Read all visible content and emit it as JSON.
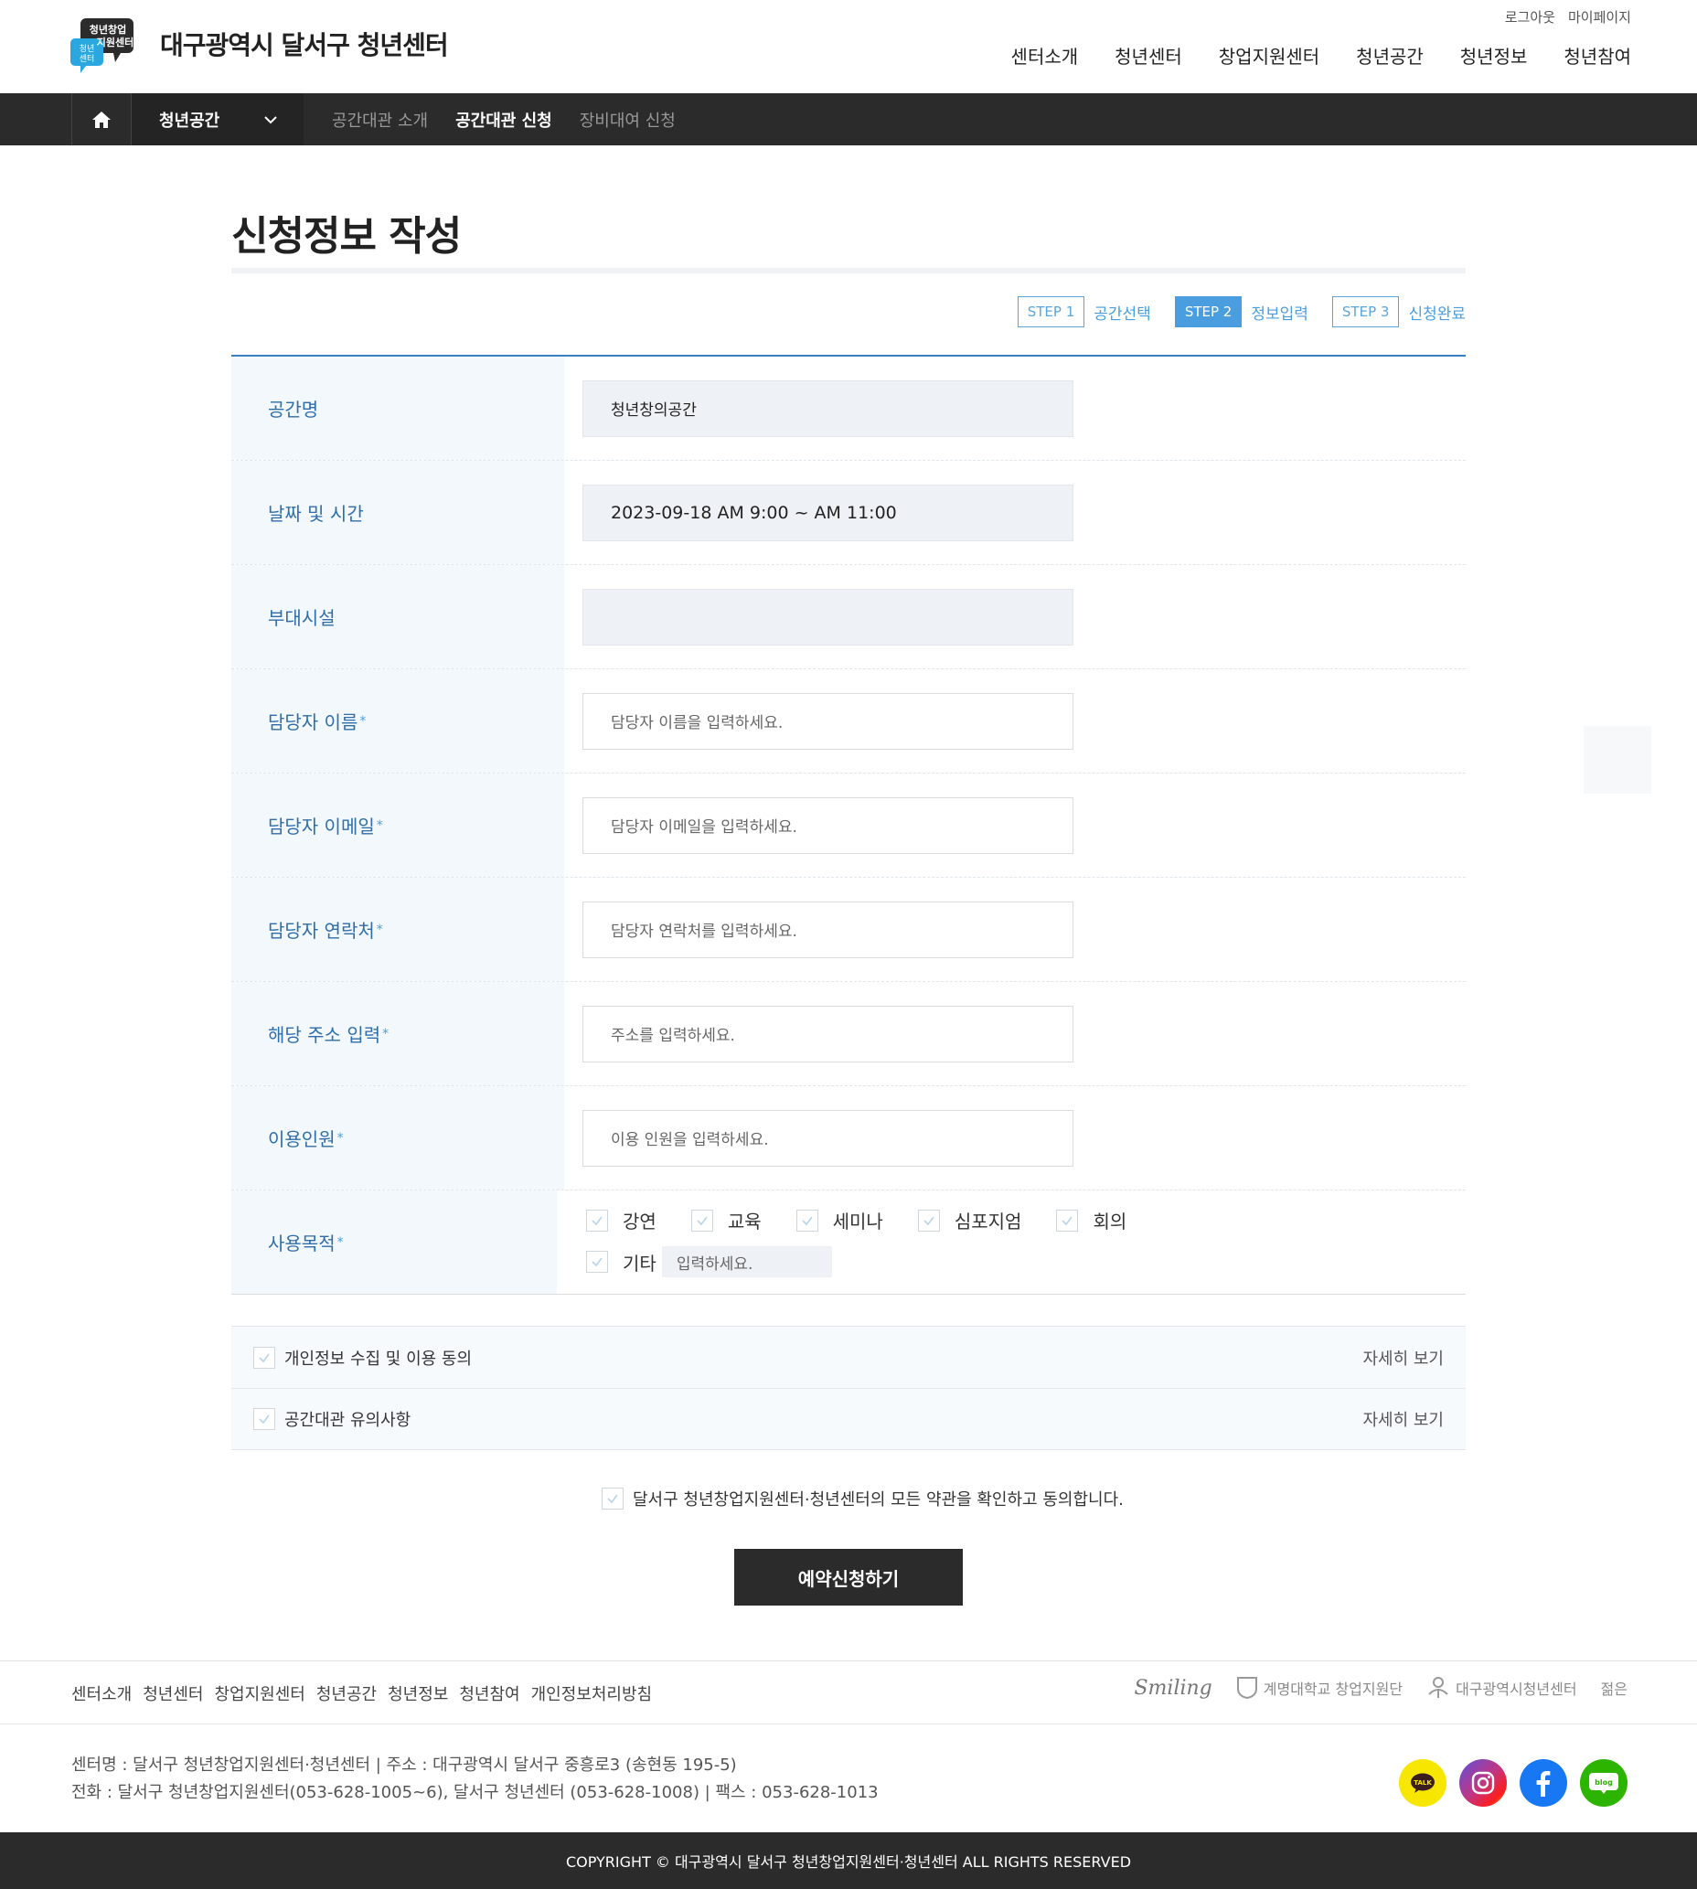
{
  "brand": {
    "logo_text": "대구광역시 달서구 청년센터",
    "logo_badge_top": "청년창업 지원센터",
    "logo_badge_bottom": "청년 센터"
  },
  "util": {
    "logout": "로그아웃",
    "mypage": "마이페이지"
  },
  "gnb": [
    "센터소개",
    "청년센터",
    "창업지원센터",
    "청년공간",
    "청년정보",
    "청년참여"
  ],
  "subnav": {
    "category": "청년공간",
    "tabs": [
      {
        "label": "공간대관 소개",
        "active": false
      },
      {
        "label": "공간대관 신청",
        "active": true
      },
      {
        "label": "장비대여 신청",
        "active": false
      }
    ]
  },
  "page": {
    "title": "신청정보 작성"
  },
  "steps": [
    {
      "badge": "STEP 1",
      "label": "공간선택",
      "active": false
    },
    {
      "badge": "STEP 2",
      "label": "정보입력",
      "active": true
    },
    {
      "badge": "STEP 3",
      "label": "신청완료",
      "active": false
    }
  ],
  "form": {
    "space_name": {
      "label": "공간명",
      "value": "청년창의공간"
    },
    "datetime": {
      "label": "날짜 및 시간",
      "value": "2023-09-18 AM 9:00 ~ AM 11:00"
    },
    "facility": {
      "label": "부대시설",
      "value": ""
    },
    "manager_name": {
      "label": "담당자 이름",
      "placeholder": "담당자 이름을 입력하세요."
    },
    "manager_email": {
      "label": "담당자 이메일",
      "placeholder": "담당자 이메일을 입력하세요."
    },
    "manager_phone": {
      "label": "담당자 연락처",
      "placeholder": "담당자 연락처를 입력하세요."
    },
    "address": {
      "label": "해당 주소 입력",
      "placeholder": "주소를 입력하세요."
    },
    "headcount": {
      "label": "이용인원",
      "placeholder": "이용 인원을 입력하세요."
    },
    "purpose": {
      "label": "사용목적",
      "options": [
        "강연",
        "교육",
        "세미나",
        "심포지엄",
        "회의"
      ],
      "etc_label": "기타",
      "etc_placeholder": "입력하세요."
    },
    "required_mark": "*"
  },
  "agreements": [
    {
      "label": "개인정보 수집 및 이용 동의",
      "more": "자세히 보기"
    },
    {
      "label": "공간대관 유의사항",
      "more": "자세히 보기"
    }
  ],
  "all_agree": "달서구 청년창업지원센터·청년센터의 모든 약관을 확인하고 동의합니다.",
  "submit": "예약신청하기",
  "footer": {
    "links": [
      "센터소개",
      "청년센터",
      "창업지원센터",
      "청년공간",
      "청년정보",
      "청년참여",
      "개인정보처리방침"
    ],
    "partners": {
      "smiling": "Smiling",
      "keimyung": "계명대학교 창업지원단",
      "daegu": "대구광역시청년센터",
      "last": "젊은"
    },
    "info_line1": "센터명 : 달서구 청년창업지원센터·청년센터 | 주소 : 대구광역시 달서구 중흥로3 (송현동 195-5)",
    "info_line2": "전화 : 달서구 청년창업지원센터(053-628-1005~6), 달서구 청년센터 (053-628-1008) | 팩스 : 053-628-1013",
    "sns": {
      "kakao": "TALK",
      "blog": "blog"
    },
    "copyright": "COPYRIGHT © 대구광역시 달서구 청년창업지원센터·청년센터 ALL RIGHTS RESERVED"
  },
  "colors": {
    "accent": "#4a9ee0",
    "label_text": "#2f6eaa",
    "label_bg": "#f2f8fc",
    "dark": "#2b2b2b"
  }
}
